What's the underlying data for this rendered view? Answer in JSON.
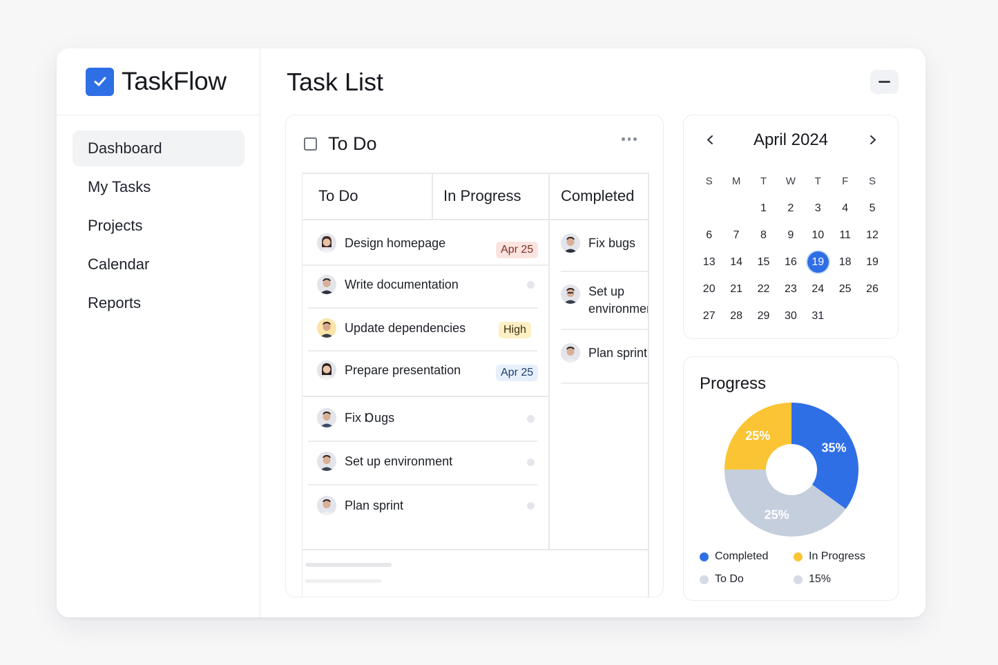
{
  "app": {
    "name": "TaskFlow",
    "logo_icon": "checkbox-logo-icon"
  },
  "sidebar": {
    "items": [
      {
        "label": "Dashboard",
        "active": true
      },
      {
        "label": "My Tasks",
        "active": false
      },
      {
        "label": "Projects",
        "active": false
      },
      {
        "label": "Calendar",
        "active": false
      },
      {
        "label": "Reports",
        "active": false
      }
    ]
  },
  "main": {
    "title": "Task List",
    "collapse_icon": "minus-icon"
  },
  "tasks_card": {
    "title": "To Do",
    "more_icon": "ellipsis-icon",
    "columns": [
      "To Do",
      "In Progress",
      "Completed"
    ],
    "todo": [
      {
        "label": "Design homepage",
        "badge": "Apr 25",
        "badge_color": "#fbe4e0"
      },
      {
        "label": "Write documentation",
        "badge": ""
      },
      {
        "label": "Update dependencies",
        "badge": "High",
        "badge_color": "#fdf0c4"
      },
      {
        "label": "Prepare presentation",
        "badge": "Apr 25",
        "badge_color": "#e7effb"
      },
      {
        "label": "Fix Ɒugs",
        "badge": ""
      },
      {
        "label": "Set up environment",
        "badge": ""
      },
      {
        "label": "Plan sprint",
        "badge": ""
      }
    ],
    "completed": [
      {
        "label": "Fix bugs"
      },
      {
        "label_line1": "Set up",
        "label_line2": "environment"
      },
      {
        "label": "Plan sprint"
      }
    ]
  },
  "calendar": {
    "month": "April 2024",
    "prev_icon": "chevron-left-icon",
    "next_icon": "chevron-right-icon",
    "weekdays": [
      "S",
      "M",
      "T",
      "W",
      "T",
      "F",
      "S"
    ],
    "weeks": [
      [
        "",
        "",
        "1",
        "2",
        "3",
        "4",
        "5"
      ],
      [
        "6",
        "7",
        "8",
        "9",
        "10",
        "11",
        "12"
      ],
      [
        "13",
        "14",
        "15",
        "16",
        "19",
        "18",
        "19"
      ],
      [
        "20",
        "21",
        "22",
        "23",
        "24",
        "25",
        "26"
      ],
      [
        "27",
        "28",
        "29",
        "30",
        "31",
        "",
        ""
      ]
    ],
    "highlighted_day": "19"
  },
  "progress": {
    "title": "Progress",
    "chart_data": {
      "type": "pie",
      "slices": [
        {
          "label": "35%",
          "value": 35,
          "color": "#2f6fe6"
        },
        {
          "label": "25%",
          "value": 40,
          "color": "#c5cedd"
        },
        {
          "label": "25%",
          "value": 25,
          "color": "#fbc434"
        }
      ]
    },
    "legend": [
      {
        "label": "Completed",
        "color": "#2f6fe6"
      },
      {
        "label": "In Progress",
        "color": "#fbc434"
      },
      {
        "label": "To Do",
        "color": "#d6dbe4"
      },
      {
        "label": "15%",
        "color": "#d6dbe4"
      }
    ]
  },
  "colors": {
    "accent": "#2f6fe6",
    "yellow": "#fbc434",
    "gray_slice": "#c5cedd"
  }
}
